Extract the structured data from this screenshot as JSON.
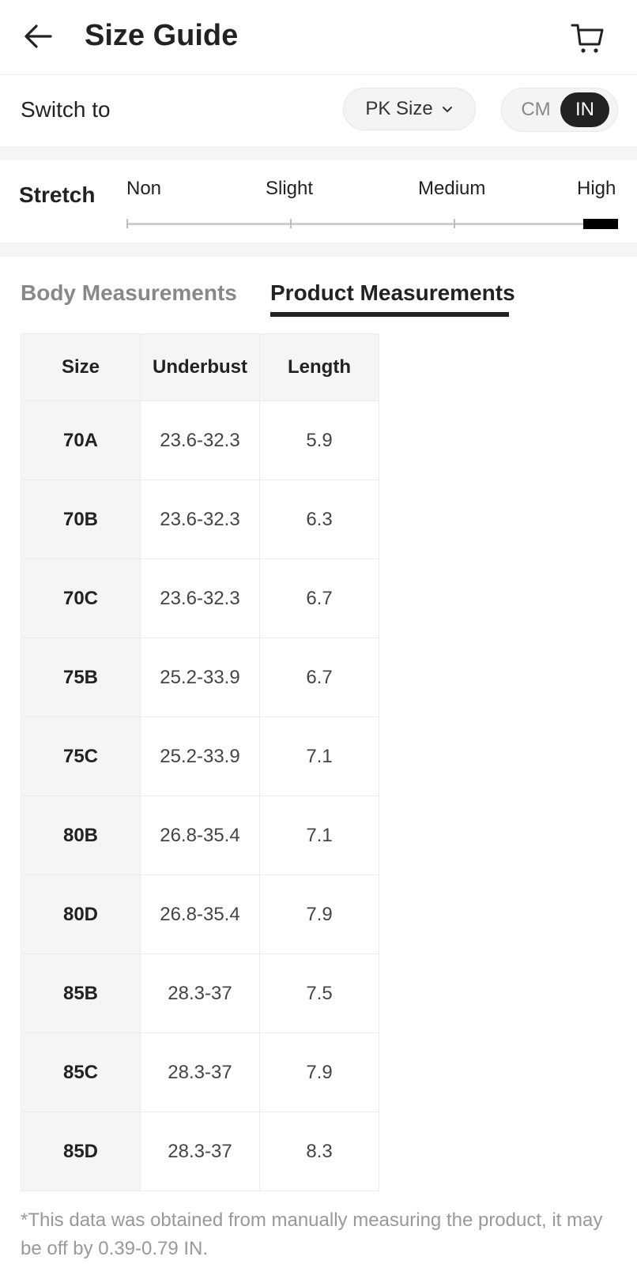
{
  "header": {
    "title": "Size Guide"
  },
  "switch_row": {
    "label": "Switch to",
    "size_select_value": "PK Size",
    "units": [
      "CM",
      "IN"
    ],
    "selected_unit": "IN"
  },
  "stretch": {
    "label": "Stretch",
    "levels": [
      "Non",
      "Slight",
      "Medium",
      "High"
    ],
    "selected_level": "High"
  },
  "tabs": [
    "Body Measurements",
    "Product Measurements"
  ],
  "selected_tab": "Product Measurements",
  "table": {
    "headers": [
      "Size",
      "Underbust",
      "Length"
    ],
    "rows": [
      [
        "70A",
        "23.6-32.3",
        "5.9"
      ],
      [
        "70B",
        "23.6-32.3",
        "6.3"
      ],
      [
        "70C",
        "23.6-32.3",
        "6.7"
      ],
      [
        "75B",
        "25.2-33.9",
        "6.7"
      ],
      [
        "75C",
        "25.2-33.9",
        "7.1"
      ],
      [
        "80B",
        "26.8-35.4",
        "7.1"
      ],
      [
        "80D",
        "26.8-35.4",
        "7.9"
      ],
      [
        "85B",
        "28.3-37",
        "7.5"
      ],
      [
        "85C",
        "28.3-37",
        "7.9"
      ],
      [
        "85D",
        "28.3-37",
        "8.3"
      ]
    ]
  },
  "footnote": "*This data was obtained from manually measuring the product, it may be off by 0.39-0.79 IN."
}
